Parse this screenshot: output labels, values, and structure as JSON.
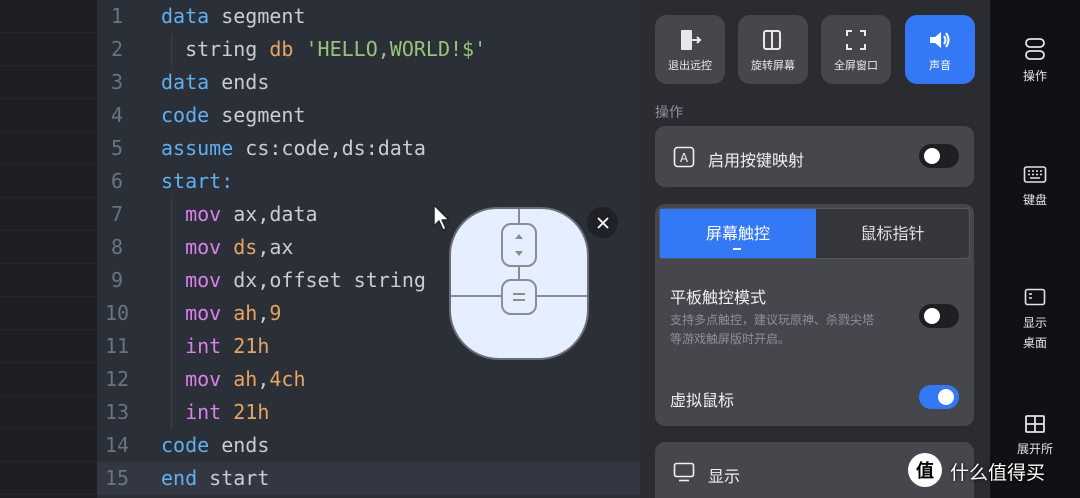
{
  "editor": {
    "lines": [
      {
        "num": "1",
        "parts": [
          [
            "kw",
            "data"
          ],
          [
            "tx",
            " segment"
          ]
        ]
      },
      {
        "num": "2",
        "parts": [
          [
            "tx",
            "  string "
          ],
          [
            "op",
            "db"
          ],
          [
            "str",
            " 'HELLO,WORLD!$'"
          ]
        ]
      },
      {
        "num": "3",
        "parts": [
          [
            "kw",
            "data"
          ],
          [
            "tx",
            " ends"
          ]
        ]
      },
      {
        "num": "4",
        "parts": [
          [
            "kw",
            "code"
          ],
          [
            "tx",
            " segment"
          ]
        ]
      },
      {
        "num": "5",
        "parts": [
          [
            "kw",
            "assume"
          ],
          [
            "tx",
            " cs:code,ds:data"
          ]
        ]
      },
      {
        "num": "6",
        "parts": [
          [
            "kw",
            "start:"
          ]
        ]
      },
      {
        "num": "7",
        "parts": [
          [
            "ty",
            "  mov"
          ],
          [
            "tx",
            " ax,data"
          ]
        ]
      },
      {
        "num": "8",
        "parts": [
          [
            "ty",
            "  mov"
          ],
          [
            "op",
            " ds"
          ],
          [
            "tx",
            ",ax"
          ]
        ]
      },
      {
        "num": "9",
        "parts": [
          [
            "ty",
            "  mov"
          ],
          [
            "tx",
            " dx,offset string"
          ]
        ]
      },
      {
        "num": "10",
        "parts": [
          [
            "ty",
            "  mov"
          ],
          [
            "op",
            " ah"
          ],
          [
            "tx",
            ","
          ],
          [
            "op",
            "9"
          ]
        ]
      },
      {
        "num": "11",
        "parts": [
          [
            "ty",
            "  int"
          ],
          [
            "op",
            " 21h"
          ]
        ]
      },
      {
        "num": "12",
        "parts": [
          [
            "ty",
            "  mov"
          ],
          [
            "op",
            " ah"
          ],
          [
            "tx",
            ","
          ],
          [
            "op",
            "4ch"
          ]
        ]
      },
      {
        "num": "13",
        "parts": [
          [
            "ty",
            "  int"
          ],
          [
            "op",
            " 21h"
          ]
        ]
      },
      {
        "num": "14",
        "parts": [
          [
            "kw",
            "code"
          ],
          [
            "tx",
            " ends"
          ]
        ]
      },
      {
        "num": "15",
        "parts": [
          [
            "kw",
            "end"
          ],
          [
            "tx",
            " start"
          ]
        ]
      }
    ],
    "current_line": "15"
  },
  "quick_buttons": {
    "exit": "退出远控",
    "rotate": "旋转屏幕",
    "fullscreen": "全屏窗口",
    "sound": "声音"
  },
  "section_title": "操作",
  "key_mapping": {
    "label": "启用按键映射",
    "on": false
  },
  "mode_tabs": {
    "touch": "屏幕触控",
    "pointer": "鼠标指针",
    "selected": "屏幕触控"
  },
  "tablet_mode": {
    "label": "平板触控模式",
    "desc": "支持多点触控，建议玩原神、杀戮尖塔等游戏触屏版时开启。",
    "on": false
  },
  "virtual_mouse": {
    "label": "虚拟鼠标",
    "on": true
  },
  "display": {
    "label": "显示"
  },
  "rail": {
    "operate": "操作",
    "keyboard": "键盘",
    "show_desktop_1": "显示",
    "show_desktop_2": "桌面",
    "expand": "展开所"
  },
  "watermark": {
    "text": "什么值得买",
    "logo_char": "值"
  },
  "colors": {
    "accent": "#3478f6",
    "keyword": "#61afef",
    "string": "#98c379",
    "instruction": "#d981e6",
    "operand": "#e5a563"
  }
}
